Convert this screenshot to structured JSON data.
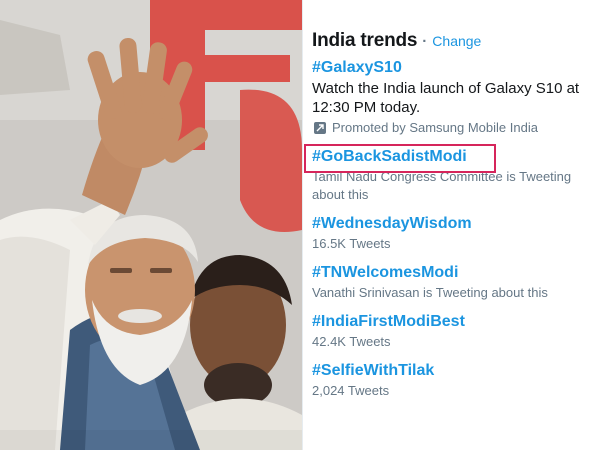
{
  "panel": {
    "title": "India trends",
    "separator": "·",
    "change_link": "Change"
  },
  "trends": [
    {
      "tag": "#GalaxyS10",
      "description": "Watch the India launch of Galaxy S10 at 12:30 PM today.",
      "promoted": "Promoted by Samsung Mobile India"
    },
    {
      "tag": "#GoBackSadistModi",
      "meta": "Tamil Nadu Congress Committee is Tweeting about this",
      "highlighted": true
    },
    {
      "tag": "#WednesdayWisdom",
      "meta": "16.5K Tweets"
    },
    {
      "tag": "#TNWelcomesModi",
      "meta": "Vanathi Srinivasan is Tweeting about this"
    },
    {
      "tag": "#IndiaFirstModiBest",
      "meta": "42.4K Tweets"
    },
    {
      "tag": "#SelfieWithTilak",
      "meta": "2,024 Tweets"
    }
  ],
  "colors": {
    "link": "#1b95e0",
    "text": "#14171a",
    "muted": "#657786",
    "highlight_box": "#d6255b",
    "background_sign": "#d9443c"
  },
  "icons": {
    "promoted": "promoted-arrow-icon"
  }
}
